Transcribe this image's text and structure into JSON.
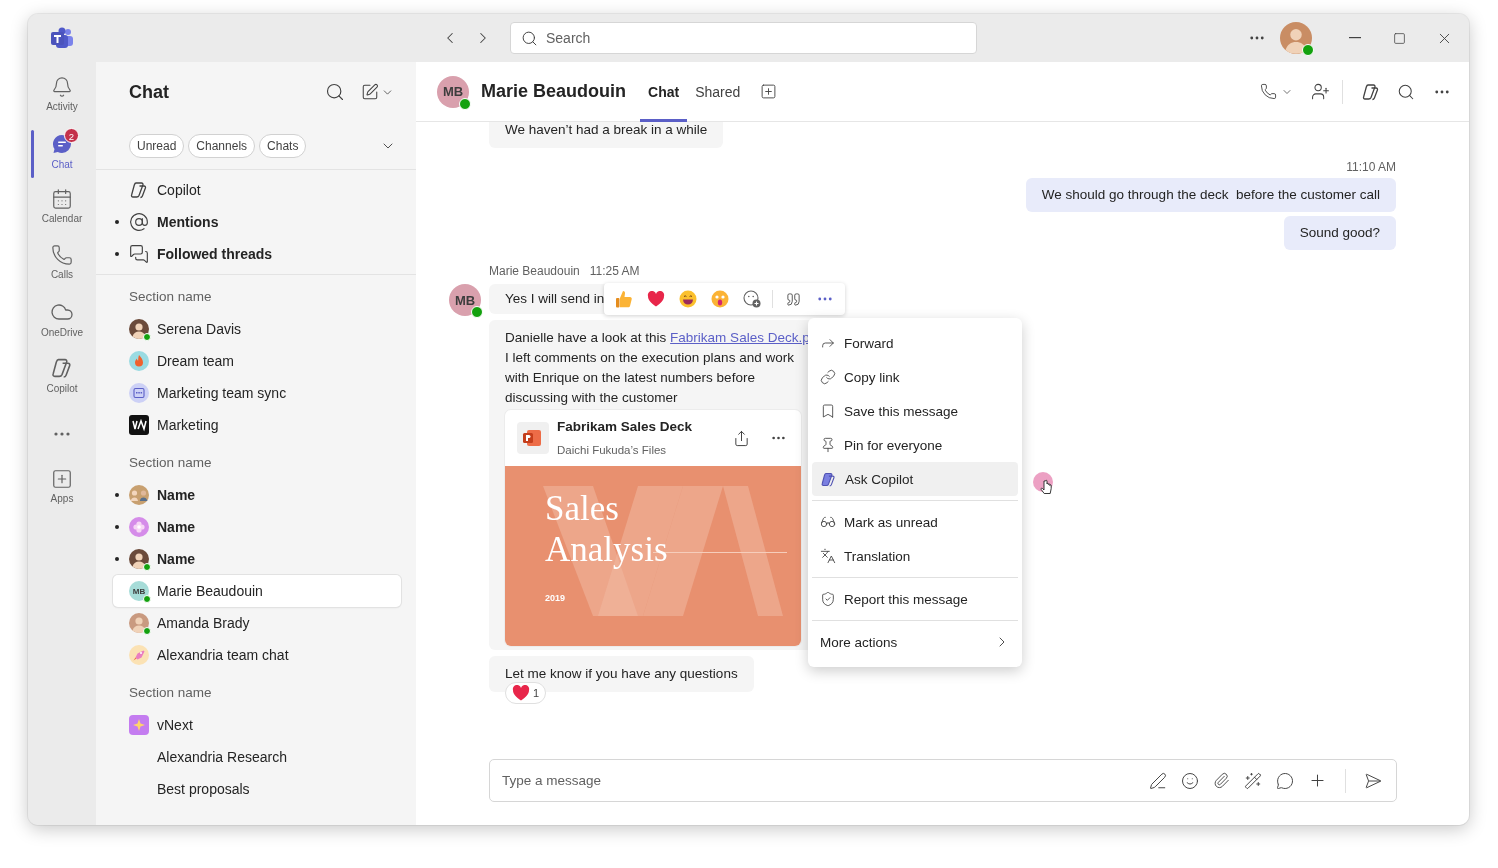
{
  "app": {
    "search_placeholder": "Search",
    "profile_online": true
  },
  "rail": [
    {
      "kind": "app",
      "label": "Activity",
      "selected": false
    },
    {
      "kind": "app",
      "label": "Chat",
      "selected": true,
      "badge": "2"
    },
    {
      "kind": "app",
      "label": "Calendar",
      "selected": false
    },
    {
      "kind": "app",
      "label": "Calls",
      "selected": false
    },
    {
      "kind": "app",
      "label": "OneDrive",
      "selected": false
    },
    {
      "kind": "app",
      "label": "Copilot",
      "selected": false
    },
    {
      "kind": "more"
    },
    {
      "kind": "app",
      "label": "Apps",
      "selected": false
    }
  ],
  "chat_list": {
    "title": "Chat",
    "filters": [
      "Unread",
      "Channels",
      "Chats"
    ],
    "pinned": [
      {
        "label": "Copilot",
        "unread": false
      },
      {
        "label": "Mentions",
        "unread": true
      },
      {
        "label": "Followed threads",
        "unread": true
      }
    ],
    "sections": [
      {
        "title": "Section name",
        "items": [
          {
            "name": "Serena Davis",
            "kind": "person",
            "online": true,
            "unread": false,
            "selected": false
          },
          {
            "name": "Dream team",
            "kind": "flame",
            "online": false,
            "unread": false,
            "selected": false
          },
          {
            "name": "Marketing team sync",
            "kind": "meeting",
            "online": false,
            "unread": false,
            "selected": false
          },
          {
            "name": "Marketing",
            "kind": "logo",
            "online": false,
            "unread": false,
            "selected": false
          }
        ]
      },
      {
        "title": "Section name",
        "items": [
          {
            "name": "Name",
            "kind": "pair",
            "online": false,
            "unread": true,
            "selected": false
          },
          {
            "name": "Name",
            "kind": "flower",
            "online": false,
            "unread": true,
            "selected": false
          },
          {
            "name": "Name",
            "kind": "person",
            "online": true,
            "unread": true,
            "selected": false
          },
          {
            "name": "Marie Beaudouin",
            "kind": "initials",
            "initials": "MB",
            "online": true,
            "unread": false,
            "selected": true
          },
          {
            "name": "Amanda Brady",
            "kind": "person",
            "online": true,
            "unread": false,
            "selected": false
          },
          {
            "name": "Alexandria team chat",
            "kind": "rocket",
            "online": false,
            "unread": false,
            "selected": false
          }
        ]
      },
      {
        "title": "Section name",
        "items": [
          {
            "name": "vNext",
            "kind": "sparkle",
            "online": false,
            "unread": false,
            "selected": false
          },
          {
            "name": "Alexandria Research",
            "kind": "plain",
            "unread": false,
            "selected": false
          },
          {
            "name": "Best proposals",
            "kind": "plain",
            "unread": false,
            "selected": false
          }
        ]
      }
    ]
  },
  "header": {
    "initials": "MB",
    "name": "Marie Beaudouin",
    "online": true,
    "tabs": [
      {
        "label": "Chat",
        "selected": true
      },
      {
        "label": "Shared",
        "selected": false
      }
    ]
  },
  "conversation": {
    "earlier": "We haven’t had a break in a while",
    "outgoing": {
      "time": "11:10 AM",
      "messages": [
        "We should go through the deck  before the customer call",
        "Sound good?"
      ]
    },
    "incoming": {
      "sender": "Marie Beaudouin",
      "time": "11:25 AM",
      "initials": "MB",
      "online": true,
      "first": "Yes I will send in",
      "lines": [
        {
          "text": "Danielle have a look at this ",
          "link": "Fabrikam Sales Deck.p"
        },
        {
          "text": "I left comments on the execution plans and work"
        },
        {
          "text": "with Enrique on the latest numbers before"
        },
        {
          "text": "discussing with the customer"
        }
      ],
      "attachment": {
        "title": "Fabrikam Sales Deck",
        "subtitle": "Daichi Fukuda’s Files",
        "slide": {
          "title_lines": [
            "Sales",
            "Analysis"
          ],
          "year": "2019"
        }
      },
      "last": "Let me know if you have any questions",
      "reaction_count": "1"
    }
  },
  "menu": {
    "groups": [
      [
        {
          "kind": "action",
          "label": "Forward",
          "selected": false
        },
        {
          "kind": "action",
          "label": "Copy link",
          "selected": false
        },
        {
          "kind": "action",
          "label": "Save this message",
          "selected": false
        },
        {
          "kind": "action",
          "label": "Pin for everyone",
          "selected": false
        },
        {
          "kind": "action",
          "label": "Ask Copilot",
          "selected": true
        }
      ],
      [
        {
          "kind": "action",
          "label": "Mark as unread",
          "selected": false
        },
        {
          "kind": "action",
          "label": "Translation",
          "selected": false
        }
      ],
      [
        {
          "kind": "action",
          "label": "Report this message",
          "selected": false
        }
      ],
      [
        {
          "kind": "submenu",
          "label": "More actions",
          "selected": false
        }
      ]
    ]
  },
  "composer": {
    "placeholder": "Type a message"
  }
}
